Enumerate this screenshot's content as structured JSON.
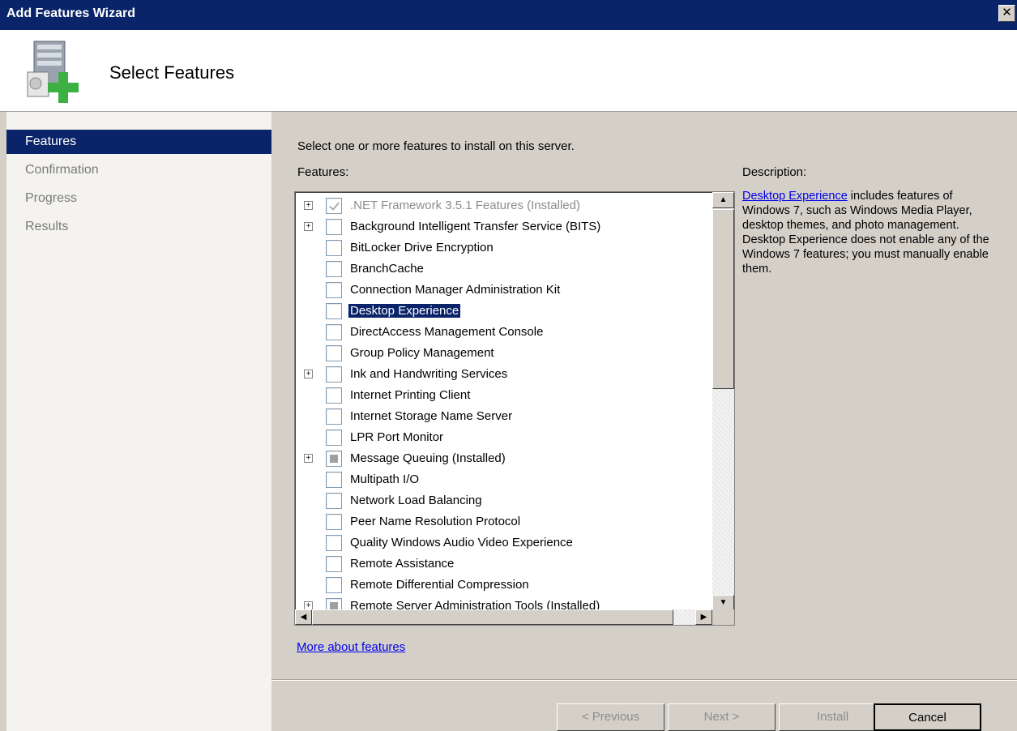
{
  "window": {
    "title": "Add Features Wizard",
    "close_glyph": "✕"
  },
  "header": {
    "page_title": "Select Features",
    "icon": "server-add-icon"
  },
  "nav": {
    "items": [
      {
        "label": "Features",
        "active": true
      },
      {
        "label": "Confirmation",
        "active": false
      },
      {
        "label": "Progress",
        "active": false
      },
      {
        "label": "Results",
        "active": false
      }
    ]
  },
  "main": {
    "instruction": "Select one or more features to install on this server.",
    "features_label": "Features:",
    "description_label": "Description:",
    "description": {
      "link_text": "Desktop Experience",
      "text": " includes features of Windows 7, such as Windows Media Player, desktop themes, and photo management. Desktop Experience does not enable any of the Windows 7 features; you must manually enable them."
    },
    "features": [
      {
        "label": ".NET Framework 3.5.1 Features  (Installed)",
        "expandable": true,
        "state": "checked",
        "disabled": true
      },
      {
        "label": "Background Intelligent Transfer Service (BITS)",
        "expandable": true,
        "state": "unchecked"
      },
      {
        "label": "BitLocker Drive Encryption",
        "expandable": false,
        "state": "unchecked"
      },
      {
        "label": "BranchCache",
        "expandable": false,
        "state": "unchecked"
      },
      {
        "label": "Connection Manager Administration Kit",
        "expandable": false,
        "state": "unchecked"
      },
      {
        "label": "Desktop Experience",
        "expandable": false,
        "state": "unchecked",
        "selected": true
      },
      {
        "label": "DirectAccess Management Console",
        "expandable": false,
        "state": "unchecked"
      },
      {
        "label": "Group Policy Management",
        "expandable": false,
        "state": "unchecked"
      },
      {
        "label": "Ink and Handwriting Services",
        "expandable": true,
        "state": "unchecked"
      },
      {
        "label": "Internet Printing Client",
        "expandable": false,
        "state": "unchecked"
      },
      {
        "label": "Internet Storage Name Server",
        "expandable": false,
        "state": "unchecked"
      },
      {
        "label": "LPR Port Monitor",
        "expandable": false,
        "state": "unchecked"
      },
      {
        "label": "Message Queuing  (Installed)",
        "expandable": true,
        "state": "partial"
      },
      {
        "label": "Multipath I/O",
        "expandable": false,
        "state": "unchecked"
      },
      {
        "label": "Network Load Balancing",
        "expandable": false,
        "state": "unchecked"
      },
      {
        "label": "Peer Name Resolution Protocol",
        "expandable": false,
        "state": "unchecked"
      },
      {
        "label": "Quality Windows Audio Video Experience",
        "expandable": false,
        "state": "unchecked"
      },
      {
        "label": "Remote Assistance",
        "expandable": false,
        "state": "unchecked"
      },
      {
        "label": "Remote Differential Compression",
        "expandable": false,
        "state": "unchecked"
      },
      {
        "label": "Remote Server Administration Tools  (Installed)",
        "expandable": true,
        "state": "partial"
      }
    ],
    "more_link": "More about features"
  },
  "buttons": {
    "previous": "< Previous",
    "next": "Next >",
    "install": "Install",
    "cancel": "Cancel"
  },
  "scrollbar_glyphs": {
    "up": "▲",
    "down": "▼",
    "left": "◀",
    "right": "▶",
    "expand": "+"
  }
}
